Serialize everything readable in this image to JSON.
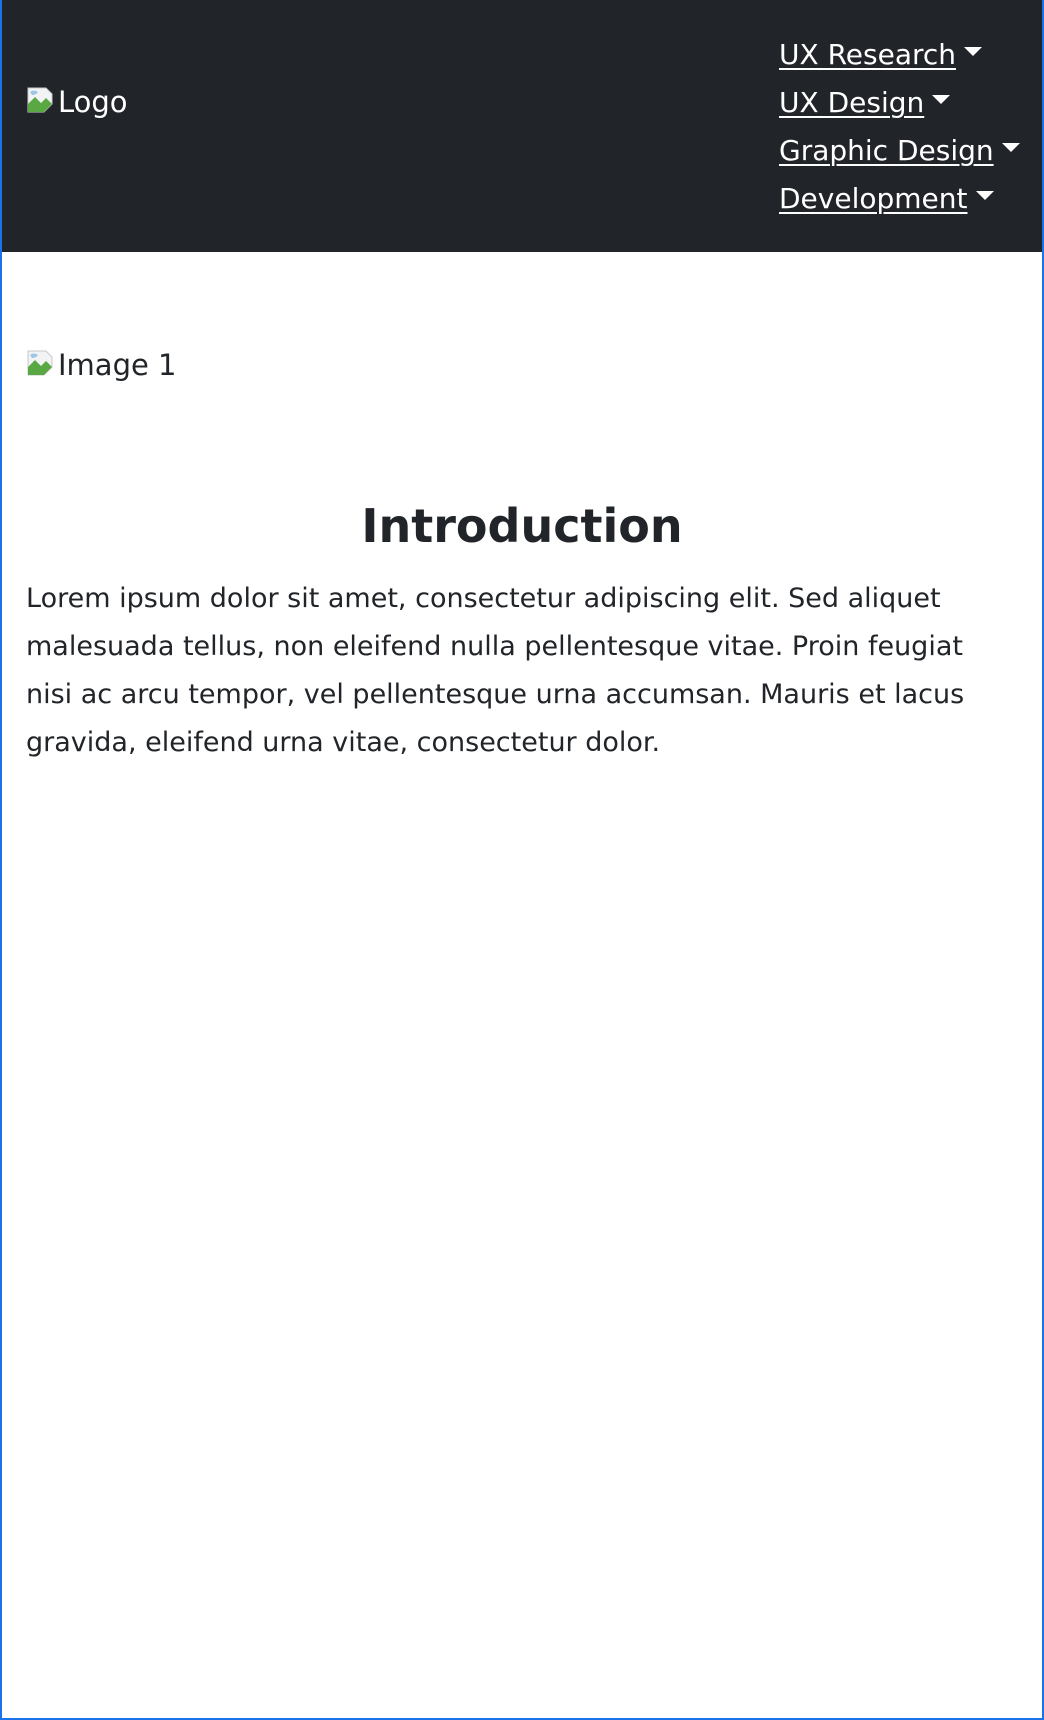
{
  "header": {
    "logo_alt": "Logo",
    "nav": [
      {
        "label": "UX Research"
      },
      {
        "label": "UX Design"
      },
      {
        "label": "Graphic Design"
      },
      {
        "label": "Development"
      }
    ]
  },
  "main": {
    "image_alt": "Image 1",
    "title": "Introduction",
    "body": "Lorem ipsum dolor sit amet, consectetur adipiscing elit. Sed aliquet malesuada tellus, non eleifend nulla pellentesque vitae. Proin feugiat nisi ac arcu tempor, vel pellentesque urna accumsan. Mauris et lacus gravida, eleifend urna vitae, consectetur dolor."
  },
  "colors": {
    "navbar_bg": "#212529",
    "nav_text": "#ffffff",
    "body_text": "#212529",
    "frame_border": "#1a73e8"
  }
}
